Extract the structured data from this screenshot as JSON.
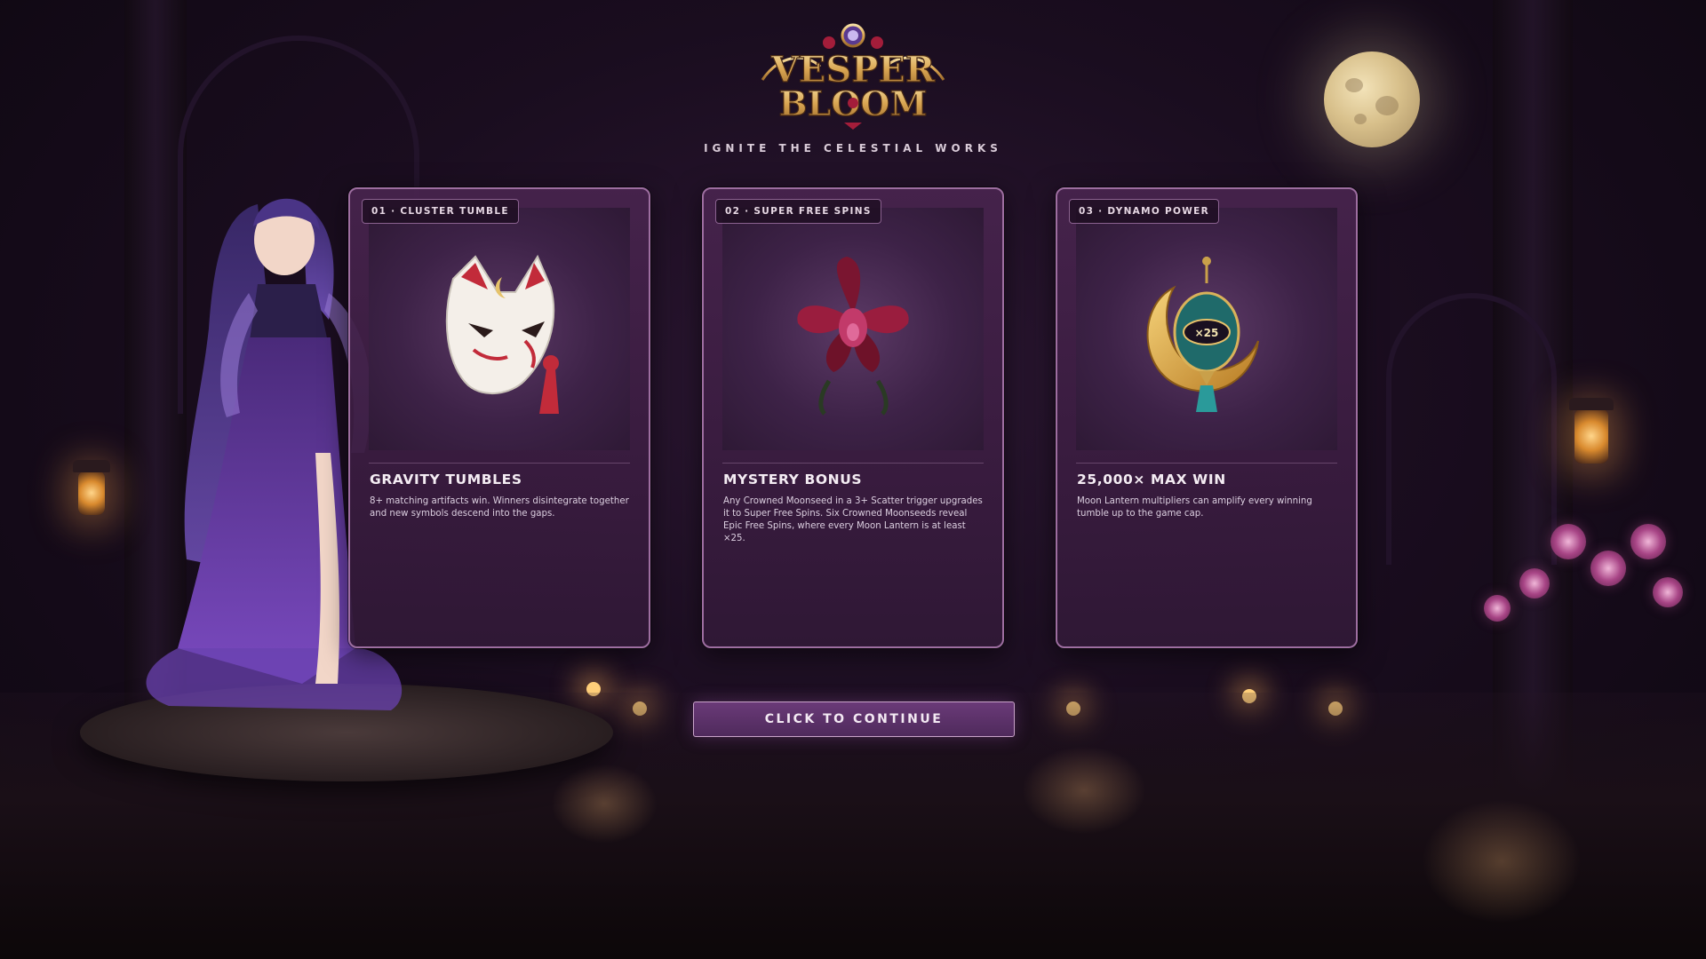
{
  "game": {
    "logo_line1": "VESPER",
    "logo_line2": "BLOOM",
    "tagline": "IGNITE THE CELESTIAL WORKS"
  },
  "features": [
    {
      "tag": "01 · CLUSTER TUMBLE",
      "title": "GRAVITY TUMBLES",
      "description": "8+ matching artifacts win. Winners disintegrate together and new symbols descend into the gaps.",
      "icon": "fox-mask-icon"
    },
    {
      "tag": "02 · SUPER FREE SPINS",
      "title": "MYSTERY BONUS",
      "description": "Any Crowned Moonseed in a 3+ Scatter trigger upgrades it to Super Free Spins. Six Crowned Moonseeds reveal Epic Free Spins, where every Moon Lantern is at least ×25.",
      "icon": "orchid-flower-icon"
    },
    {
      "tag": "03 · DYNAMO POWER",
      "title": "25,000× MAX WIN",
      "description": "Moon Lantern multipliers can amplify every winning tumble up to the game cap.",
      "icon": "moon-lantern-icon",
      "lantern_label": "×25"
    }
  ],
  "continue_label": "CLICK TO CONTINUE",
  "colors": {
    "background": "#1a0d1f",
    "card_border": "#9d6ea0",
    "card_fill": "#48244e",
    "button_fill": "#5c3268",
    "logo_gold": "#e2b96a",
    "logo_red": "#a31d3a"
  }
}
